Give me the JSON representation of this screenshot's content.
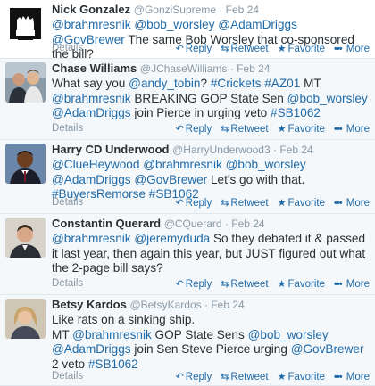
{
  "actions": {
    "details": "Details",
    "reply": "Reply",
    "retweet": "Retweet",
    "favorite": "Favorite",
    "more": "More"
  },
  "tweets": [
    {
      "fullname": "Nick Gonzalez",
      "handle": "@GonziSupreme",
      "time": "Feb 24",
      "segments": [
        {
          "t": "@brahmresnik",
          "link": true
        },
        {
          "t": " "
        },
        {
          "t": "@bob_worsley",
          "link": true
        },
        {
          "t": " "
        },
        {
          "t": "@AdamDriggs",
          "link": true
        },
        {
          "t": " "
        },
        {
          "t": "@GovBrewer",
          "link": true
        },
        {
          "t": " The same Bob Worsley that co-sponsored the bill?"
        }
      ]
    },
    {
      "fullname": "Chase Williams",
      "handle": "@JChaseWilliams",
      "time": "Feb 24",
      "segments": [
        {
          "t": "What say you "
        },
        {
          "t": "@andy_tobin",
          "link": true
        },
        {
          "t": "? "
        },
        {
          "t": "#Crickets",
          "link": true
        },
        {
          "t": " "
        },
        {
          "t": "#AZ01",
          "link": true
        },
        {
          "t": " MT "
        },
        {
          "t": "@brahmresnik",
          "link": true
        },
        {
          "t": " BREAKING GOP State Sen "
        },
        {
          "t": "@bob_worsley",
          "link": true
        },
        {
          "t": " "
        },
        {
          "t": "@AdamDriggs",
          "link": true
        },
        {
          "t": " join Pierce in urging veto "
        },
        {
          "t": "#SB1062",
          "link": true
        }
      ]
    },
    {
      "fullname": "Harry CD Underwood",
      "handle": "@HarryUnderwood3",
      "time": "Feb 24",
      "segments": [
        {
          "t": "@ClueHeywood",
          "link": true
        },
        {
          "t": " "
        },
        {
          "t": "@brahmresnik",
          "link": true
        },
        {
          "t": " "
        },
        {
          "t": "@bob_worsley",
          "link": true
        },
        {
          "t": " "
        },
        {
          "t": "@AdamDriggs",
          "link": true
        },
        {
          "t": " "
        },
        {
          "t": "@GovBrewer",
          "link": true
        },
        {
          "t": " Let's go with that. "
        },
        {
          "t": "#BuyersRemorse",
          "link": true
        },
        {
          "t": " "
        },
        {
          "t": "#SB1062",
          "link": true
        }
      ]
    },
    {
      "fullname": "Constantin Querard",
      "handle": "@CQuerard",
      "time": "Feb 24",
      "segments": [
        {
          "t": "@brahmresnik",
          "link": true
        },
        {
          "t": " "
        },
        {
          "t": "@jeremyduda",
          "link": true
        },
        {
          "t": " So they debated it & passed it last year, then again this year, but JUST figured out what the 2-page bill says?"
        }
      ]
    },
    {
      "fullname": "Betsy Kardos",
      "handle": "@BetsyKardos",
      "time": "Feb 24",
      "segments": [
        {
          "t": "Like rats on a sinking ship."
        },
        {
          "br": true
        },
        {
          "t": "MT "
        },
        {
          "t": "@brahmresnik",
          "link": true
        },
        {
          "t": " GOP State Sens "
        },
        {
          "t": "@bob_worsley",
          "link": true
        },
        {
          "t": " "
        },
        {
          "t": "@AdamDriggs",
          "link": true
        },
        {
          "t": " join Sen Steve Pierce urging "
        },
        {
          "t": "@GovBrewer",
          "link": true
        },
        {
          "t": " 2 veto "
        },
        {
          "t": "#SB1062",
          "link": true
        }
      ]
    }
  ]
}
